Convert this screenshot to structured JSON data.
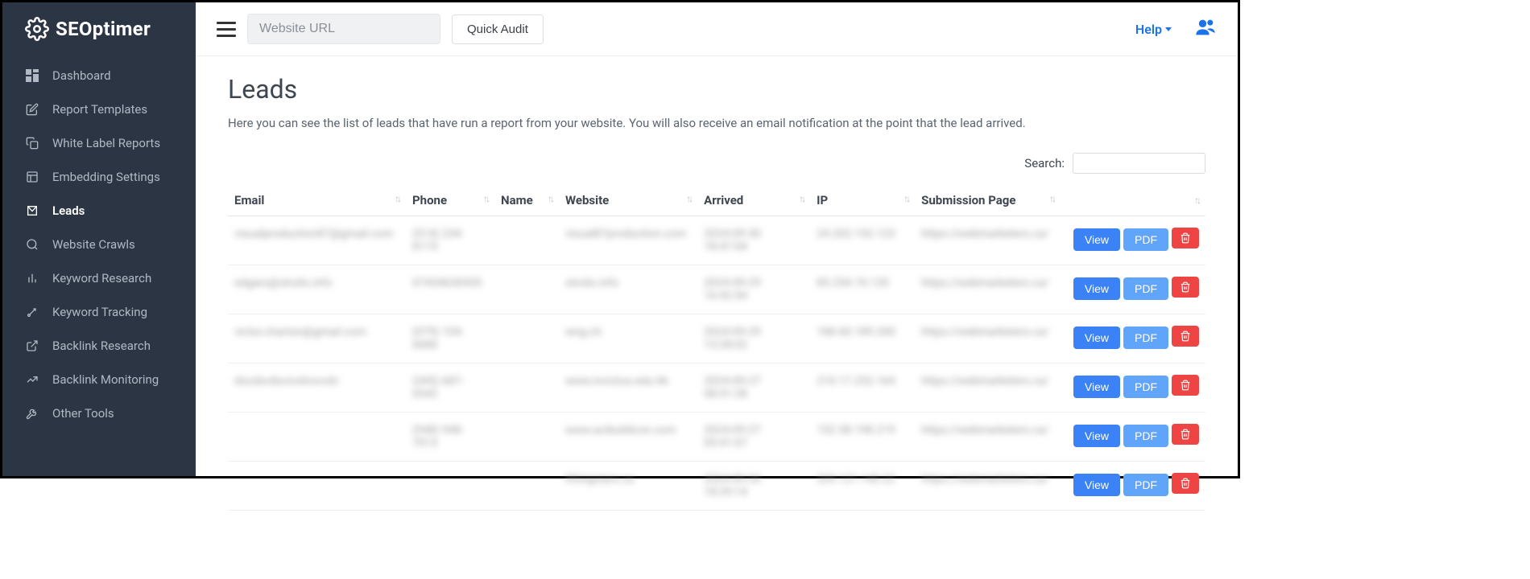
{
  "brand": "SEOptimer",
  "sidebar": {
    "items": [
      {
        "label": "Dashboard",
        "active": false
      },
      {
        "label": "Report Templates",
        "active": false
      },
      {
        "label": "White Label Reports",
        "active": false
      },
      {
        "label": "Embedding Settings",
        "active": false
      },
      {
        "label": "Leads",
        "active": true
      },
      {
        "label": "Website Crawls",
        "active": false
      },
      {
        "label": "Keyword Research",
        "active": false
      },
      {
        "label": "Keyword Tracking",
        "active": false
      },
      {
        "label": "Backlink Research",
        "active": false
      },
      {
        "label": "Backlink Monitoring",
        "active": false
      },
      {
        "label": "Other Tools",
        "active": false
      }
    ]
  },
  "topbar": {
    "urlPlaceholder": "Website URL",
    "quickAudit": "Quick Audit",
    "help": "Help"
  },
  "page": {
    "title": "Leads",
    "description": "Here you can see the list of leads that have run a report from your website. You will also receive an email notification at the point that the lead arrived.",
    "searchLabel": "Search:"
  },
  "table": {
    "headers": {
      "email": "Email",
      "phone": "Phone",
      "name": "Name",
      "website": "Website",
      "arrived": "Arrived",
      "ip": "IP",
      "submission": "Submission Page"
    },
    "actions": {
      "view": "View",
      "pdf": "PDF"
    },
    "rows": [
      {
        "email": "visualproduction87@gmail.com",
        "phone": "(514) 234-8173",
        "name": "",
        "website": "visual87production.com",
        "arrived": "2024-09-30 18:47:04",
        "ip": "24.202.152.123",
        "submission": "https://webmarketers.ca/"
      },
      {
        "email": "edgars@strolis.info",
        "phone": "07434630435",
        "name": "",
        "website": "strolis.info",
        "arrived": "2024-09-29 16:42:54",
        "ip": "85.254.74.135",
        "submission": "https://webmarketers.ca/"
      },
      {
        "email": "victor.charton@gmail.com",
        "phone": "(079) 104-6680",
        "name": "",
        "website": "wng.ch",
        "arrived": "2024-09-29 13:28:02",
        "ip": "188.60.189.200",
        "submission": "https://webmarketers.ca/"
      },
      {
        "email": "dscdxvdsvsvdvsvvdv",
        "phone": "(345) 687-6542",
        "name": "",
        "website": "www.invictus.edu.hk",
        "arrived": "2024-09-27 08:51:28",
        "ip": "210.17.252.164",
        "submission": "https://webmarketers.ca/"
      },
      {
        "email": "",
        "phone": "(948) 948-7013",
        "name": "",
        "website": "www.acibuildcon.com",
        "arrived": "2024-09-27 05:41:07",
        "ip": "152.58.198.219",
        "submission": "https://webmarketers.ca/"
      },
      {
        "email": "",
        "phone": "",
        "name": "",
        "website": "liftingstars.ca",
        "arrived": "2024-09-26 18:29:14",
        "ip": "209.121.140.22",
        "submission": "https://webmarketers.ca/"
      }
    ]
  }
}
